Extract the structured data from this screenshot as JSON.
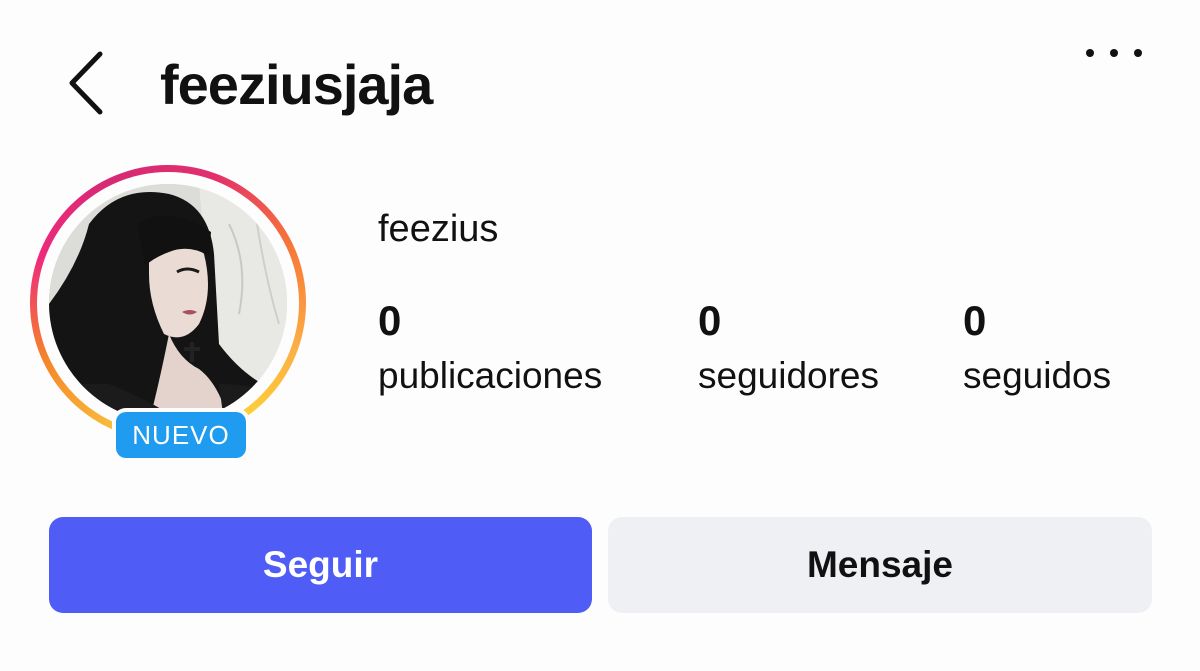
{
  "header": {
    "username": "feeziusjaja",
    "back_icon": "chevron-left-icon",
    "more_icon": "more-horizontal-icon"
  },
  "profile": {
    "display_name": "feezius",
    "badge": "NUEVO",
    "ring_colors": [
      "#fcaf45",
      "#f58529",
      "#ee2a7b",
      "#d62976"
    ],
    "badge_color": "#1f9bf0"
  },
  "stats": [
    {
      "value": "0",
      "label": "publicaciones"
    },
    {
      "value": "0",
      "label": "seguidores"
    },
    {
      "value": "0",
      "label": "seguidos"
    }
  ],
  "actions": {
    "follow_label": "Seguir",
    "follow_color": "#4f5cf5",
    "message_label": "Mensaje",
    "message_color": "#eff0f3"
  }
}
